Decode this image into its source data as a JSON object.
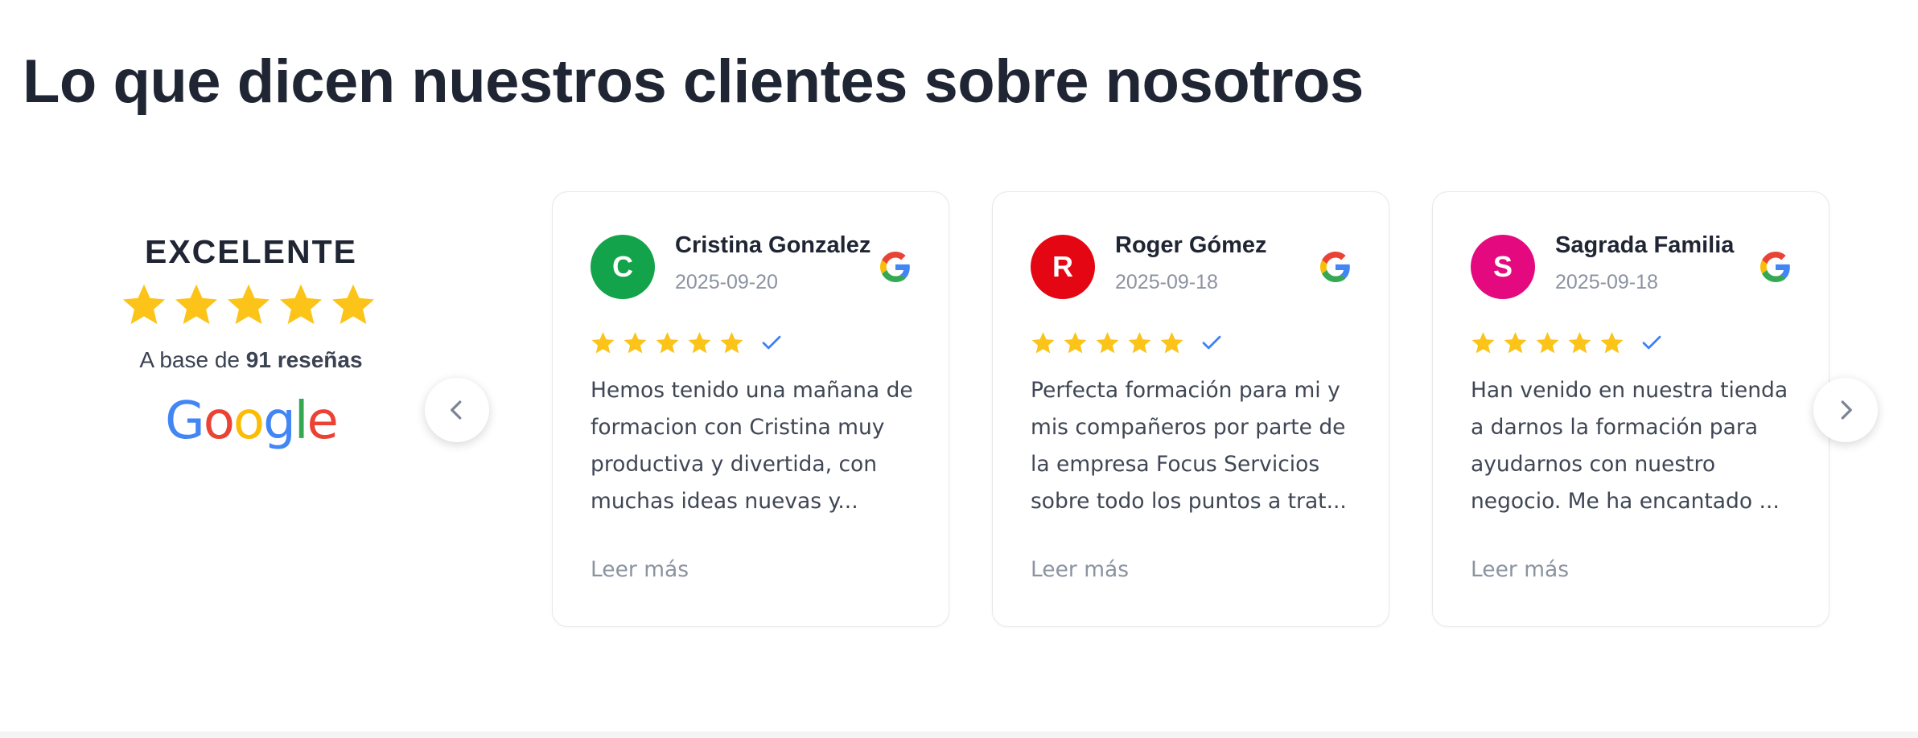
{
  "section": {
    "title": "Lo que dicen nuestros clientes sobre nosotros"
  },
  "summary": {
    "rating_label": "EXCELENTE",
    "stars": 5,
    "count_prefix": "A base de ",
    "count_bold": "91 reseñas",
    "brand": "Google",
    "star_color": "#fcc419"
  },
  "carousel": {
    "prev_icon": "chevron-left-icon",
    "next_icon": "chevron-right-icon"
  },
  "reviews": [
    {
      "initial": "C",
      "avatar_color": "#13a34a",
      "name": "Cristina Gonzalez",
      "date": "2025-09-20",
      "stars": 5,
      "verified_icon": "check-icon",
      "text": "Hemos tenido una mañana de formacion con Cristina muy productiva y divertida, con muchas ideas nuevas y...",
      "read_more": "Leer más"
    },
    {
      "initial": "R",
      "avatar_color": "#e40613",
      "name": "Roger Gómez",
      "date": "2025-09-18",
      "stars": 5,
      "verified_icon": "check-icon",
      "text": "Perfecta formación para mi y mis compañeros por parte de la empresa Focus Servicios sobre todo los puntos a trat...",
      "read_more": "Leer más"
    },
    {
      "initial": "S",
      "avatar_color": "#e5097f",
      "name": "Sagrada Familia",
      "date": "2025-09-18",
      "stars": 5,
      "verified_icon": "check-icon",
      "text": "Han venido en nuestra tienda a darnos la formación para ayudarnos con nuestro negocio. Me ha encantado ...",
      "read_more": "Leer más"
    }
  ]
}
